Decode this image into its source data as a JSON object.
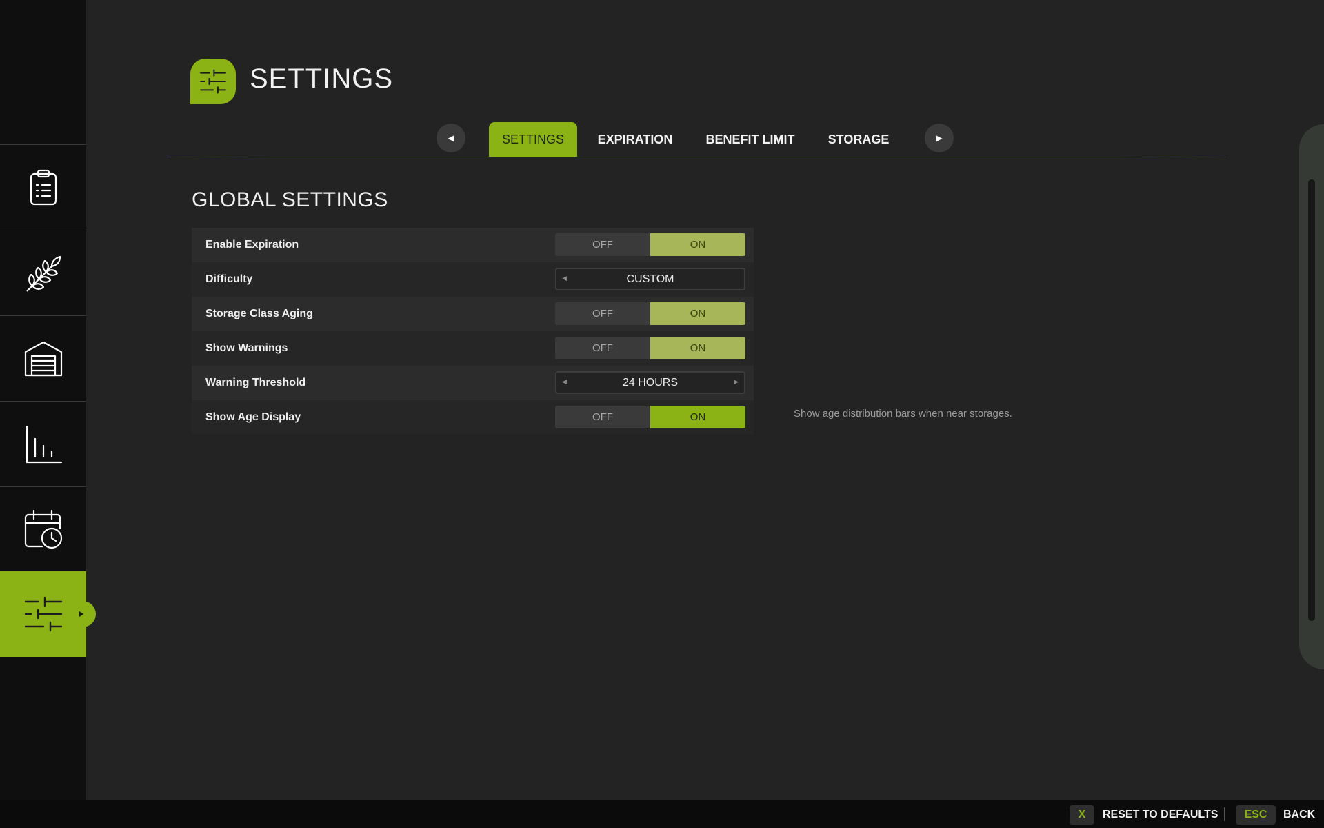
{
  "header": {
    "title": "SETTINGS",
    "logo_icon": "sliders-icon"
  },
  "sidebar": {
    "items": [
      {
        "icon": "clipboard-checklist-icon",
        "active": false
      },
      {
        "icon": "wheat-icon",
        "active": false
      },
      {
        "icon": "storage-garage-icon",
        "active": false
      },
      {
        "icon": "bar-chart-icon",
        "active": false
      },
      {
        "icon": "calendar-clock-icon",
        "active": false
      },
      {
        "icon": "sliders-icon",
        "active": true
      }
    ]
  },
  "tabs": {
    "prev_icon": "chevron-left-icon",
    "next_icon": "chevron-right-icon",
    "items": [
      {
        "label": "SETTINGS",
        "active": true
      },
      {
        "label": "EXPIRATION",
        "active": false
      },
      {
        "label": "BENEFIT LIMIT",
        "active": false
      },
      {
        "label": "STORAGE",
        "active": false
      }
    ]
  },
  "section": {
    "title": "GLOBAL SETTINGS",
    "rows": [
      {
        "label": "Enable Expiration",
        "type": "toggle",
        "off": "OFF",
        "on": "ON",
        "value": "ON"
      },
      {
        "label": "Difficulty",
        "type": "selector",
        "value": "CUSTOM"
      },
      {
        "label": "Storage Class Aging",
        "type": "toggle",
        "off": "OFF",
        "on": "ON",
        "value": "ON"
      },
      {
        "label": "Show Warnings",
        "type": "toggle",
        "off": "OFF",
        "on": "ON",
        "value": "ON"
      },
      {
        "label": "Warning Threshold",
        "type": "selector",
        "value": "24 HOURS"
      },
      {
        "label": "Show Age Display",
        "type": "toggle",
        "off": "OFF",
        "on": "ON",
        "value": "ON",
        "focused": true
      }
    ],
    "hint": "Show age distribution bars when near storages."
  },
  "footer": {
    "reset_key": "X",
    "reset_label": "RESET TO DEFAULTS",
    "back_key": "ESC",
    "back_label": "BACK"
  },
  "colors": {
    "accent": "#8bb316",
    "toggle_on": "#a7b659",
    "background": "#232323",
    "sidebar": "#0f0f0f"
  }
}
